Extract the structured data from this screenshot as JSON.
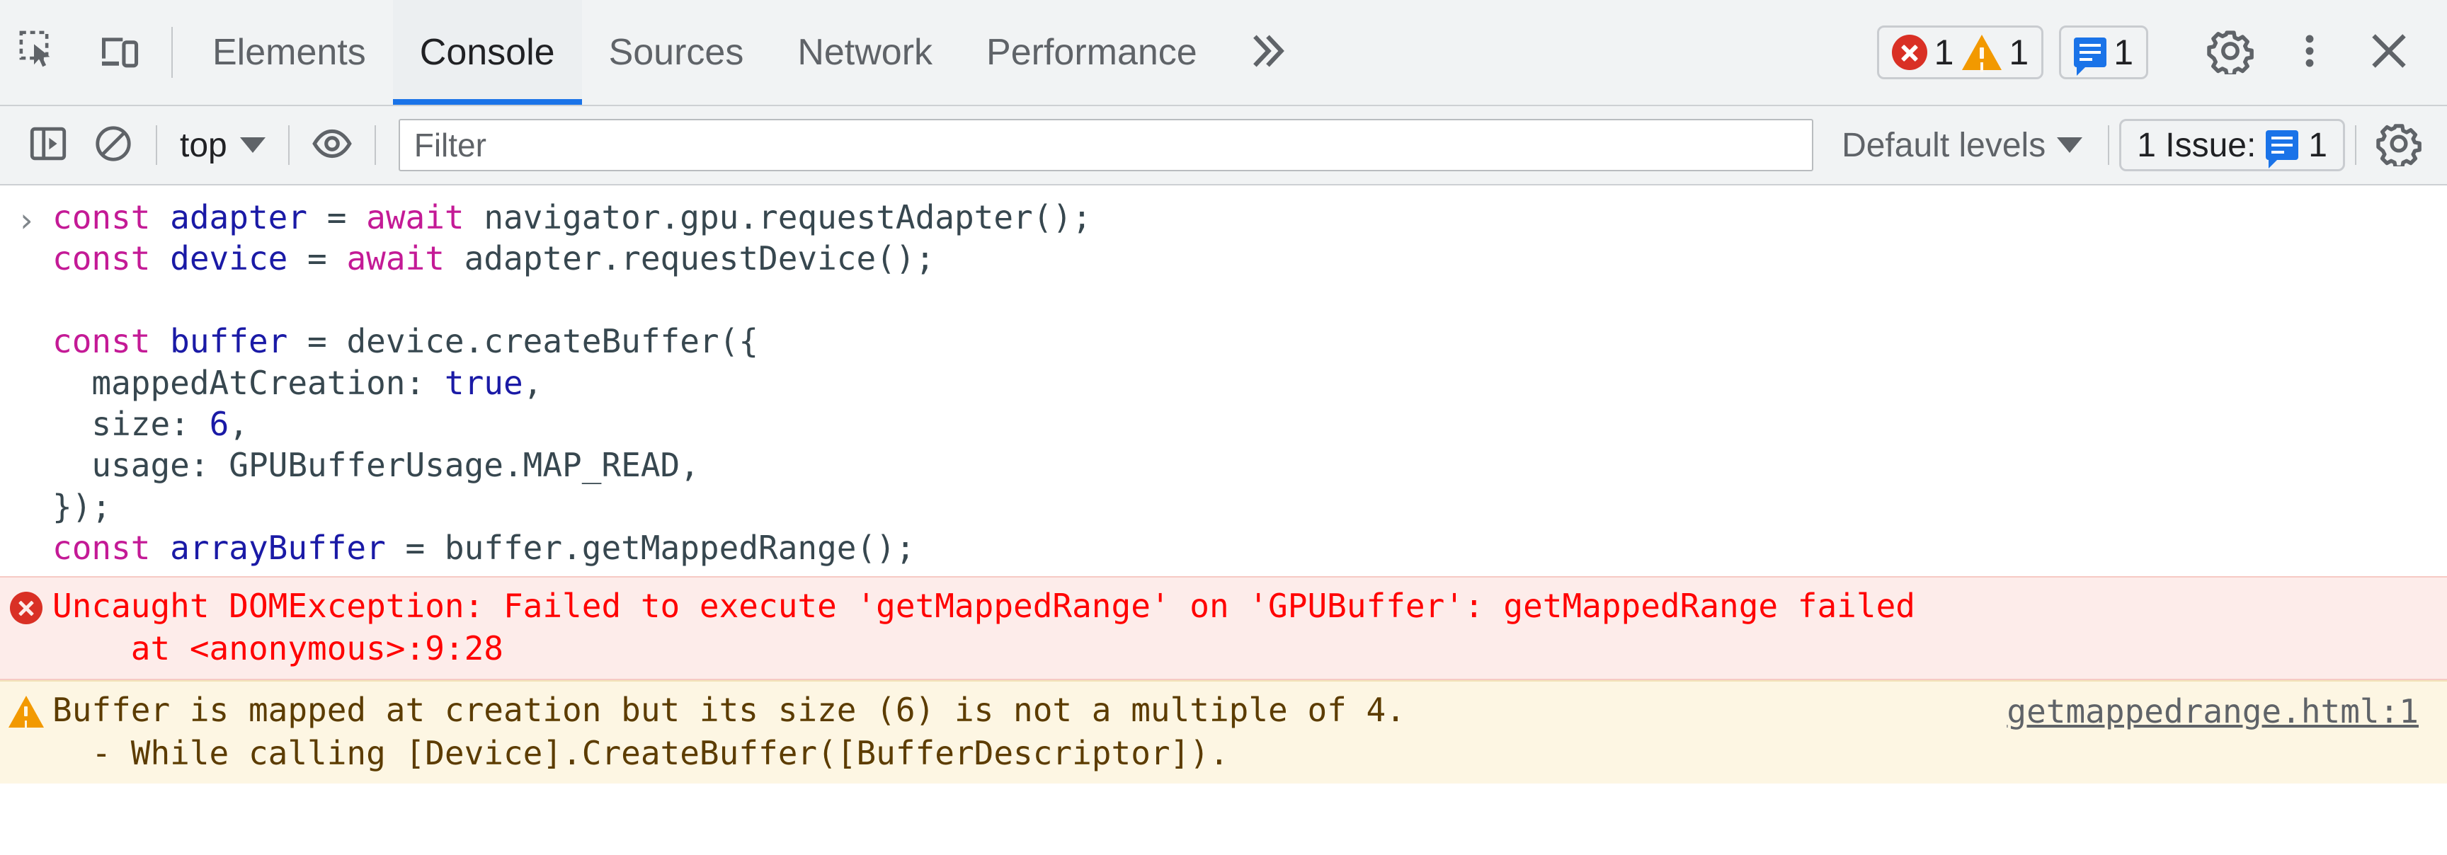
{
  "tabbar": {
    "inspect_icon": "inspect-element-icon",
    "device_icon": "device-toolbar-icon",
    "tabs": [
      {
        "label": "Elements",
        "active": false
      },
      {
        "label": "Console",
        "active": true
      },
      {
        "label": "Sources",
        "active": false
      },
      {
        "label": "Network",
        "active": false
      },
      {
        "label": "Performance",
        "active": false
      }
    ],
    "overflow_label": "»",
    "error_count": "1",
    "warning_count": "1",
    "info_count": "1",
    "settings_icon": "gear-icon",
    "more_icon": "kebab-menu-icon",
    "close_icon": "close-icon"
  },
  "console_toolbar": {
    "sidebar_toggle_icon": "console-sidebar-icon",
    "clear_icon": "clear-console-icon",
    "context": "top",
    "eye_icon": "live-expression-icon",
    "filter_placeholder": "Filter",
    "filter_value": "",
    "levels_label": "Default levels",
    "issues_label": "1 Issue:",
    "issues_count": "1",
    "settings_icon": "console-settings-gear-icon"
  },
  "console": {
    "prompt_arrow": "›",
    "code_lines": [
      [
        {
          "t": "const ",
          "c": "kw"
        },
        {
          "t": "adapter",
          "c": "var"
        },
        {
          "t": " = ",
          "c": "op"
        },
        {
          "t": "await ",
          "c": "kw"
        },
        {
          "t": "navigator.gpu.requestAdapter();",
          "c": "op"
        }
      ],
      [
        {
          "t": "const ",
          "c": "kw"
        },
        {
          "t": "device",
          "c": "var"
        },
        {
          "t": " = ",
          "c": "op"
        },
        {
          "t": "await ",
          "c": "kw"
        },
        {
          "t": "adapter.requestDevice();",
          "c": "op"
        }
      ],
      [
        {
          "t": "",
          "c": "op"
        }
      ],
      [
        {
          "t": "const ",
          "c": "kw"
        },
        {
          "t": "buffer",
          "c": "var"
        },
        {
          "t": " = ",
          "c": "op"
        },
        {
          "t": "device.createBuffer({",
          "c": "op"
        }
      ],
      [
        {
          "t": "  mappedAtCreation: ",
          "c": "op"
        },
        {
          "t": "true",
          "c": "lit"
        },
        {
          "t": ",",
          "c": "op"
        }
      ],
      [
        {
          "t": "  size: ",
          "c": "op"
        },
        {
          "t": "6",
          "c": "lit"
        },
        {
          "t": ",",
          "c": "op"
        }
      ],
      [
        {
          "t": "  usage: GPUBufferUsage.MAP_READ,",
          "c": "op"
        }
      ],
      [
        {
          "t": "});",
          "c": "op"
        }
      ],
      [
        {
          "t": "const ",
          "c": "kw"
        },
        {
          "t": "arrayBuffer",
          "c": "var"
        },
        {
          "t": " = ",
          "c": "op"
        },
        {
          "t": "buffer.getMappedRange();",
          "c": "op"
        }
      ]
    ],
    "error_message": "Uncaught DOMException: Failed to execute 'getMappedRange' on 'GPUBuffer': getMappedRange failed\n    at <anonymous>:9:28",
    "warning_message": "Buffer is mapped at creation but its size (6) is not a multiple of 4.\n  - While calling [Device].CreateBuffer([BufferDescriptor]).",
    "warning_link": "getmappedrange.html:1"
  },
  "colors": {
    "accent": "#1a73e8",
    "error": "#d93025",
    "warning": "#f29900",
    "error_bg": "#fdecea",
    "warning_bg": "#fdf6e3"
  }
}
